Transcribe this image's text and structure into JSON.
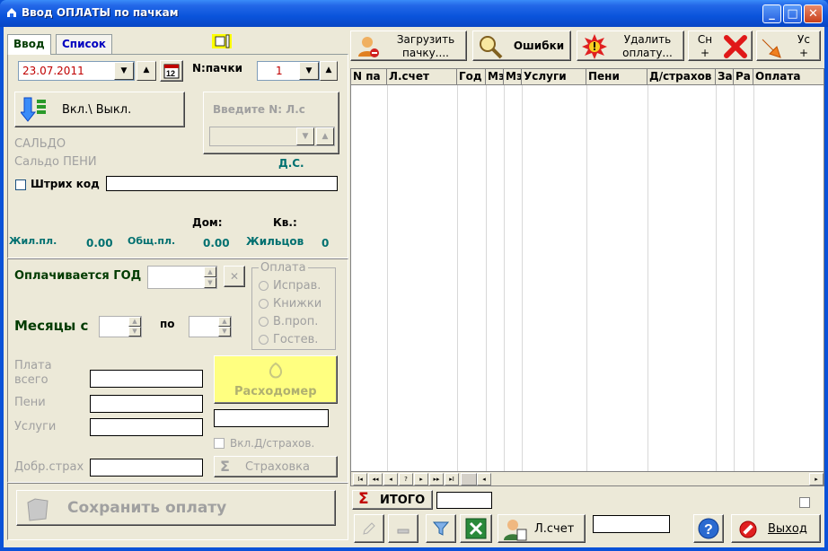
{
  "window": {
    "title": "Ввод ОПЛАТЫ по пачкам"
  },
  "tabs": [
    {
      "label": "Ввод"
    },
    {
      "label": "Список"
    }
  ],
  "date_value": "23.07.2011",
  "pack": {
    "label": "N:пачки",
    "value": "1"
  },
  "toggle_button": "Вкл.\\ Выкл.",
  "account_entry": {
    "label": "Введите N: Л.с"
  },
  "saldo": "САЛЬДО",
  "saldo_peni": "Сальдо ПЕНИ",
  "ds_label": "Д.С.",
  "barcode_label": "Штрих код",
  "house_label": "Дом:",
  "flat_label": "Кв.:",
  "living_area_label": "Жил.пл.",
  "living_area_value": "0.00",
  "total_area_label": "Общ.пл.",
  "total_area_value": "0.00",
  "residents_label": "Жильцов",
  "residents_value": "0",
  "year_label": "Оплачивается ГОД",
  "clear_btn": "✕",
  "payment_group": {
    "title": "Оплата",
    "options": [
      "Исправ.",
      "Книжки",
      "В.проп.",
      "Гостев."
    ]
  },
  "months_from": "Месяцы с",
  "months_to": "по",
  "pay_total": "Плата всего",
  "pay_total_1": "Плата",
  "pay_total_2": "всего",
  "peni": "Пени",
  "services": "Услуги",
  "vol_insurance": "Добр.страх",
  "meter_btn": "Расходомер",
  "incl_insurance": "Вкл.Д/страхов.",
  "insurance_btn": "Страховка",
  "save_btn": "Сохранить оплату",
  "toolbar": {
    "load_1": "Загрузить",
    "load_2": "пачку....",
    "errors": "Ошибки",
    "delete_1": "Удалить",
    "delete_2": "оплату...",
    "sn_1": "Сн",
    "sn_2": "+",
    "us_1": "Ус",
    "us_2": "+"
  },
  "grid_columns": [
    "N па",
    "Л.счет",
    "Год",
    "Мэ",
    "Мэ",
    "Услуги",
    "Пени",
    "Д/страхов",
    "За",
    "Ра",
    "Оплата"
  ],
  "nav_buttons": [
    "I◂",
    "◂◂",
    "◂",
    "?",
    "▸",
    "▸▸",
    "▸I"
  ],
  "total_label": "ИТОГО",
  "account_btn": "Л.счет",
  "help_btn": "?",
  "exit_btn": "Выход",
  "colors": {
    "titlebar": "#0a54dc",
    "meter": "#ffff80",
    "teal": "#007070",
    "date": "#c00000"
  }
}
